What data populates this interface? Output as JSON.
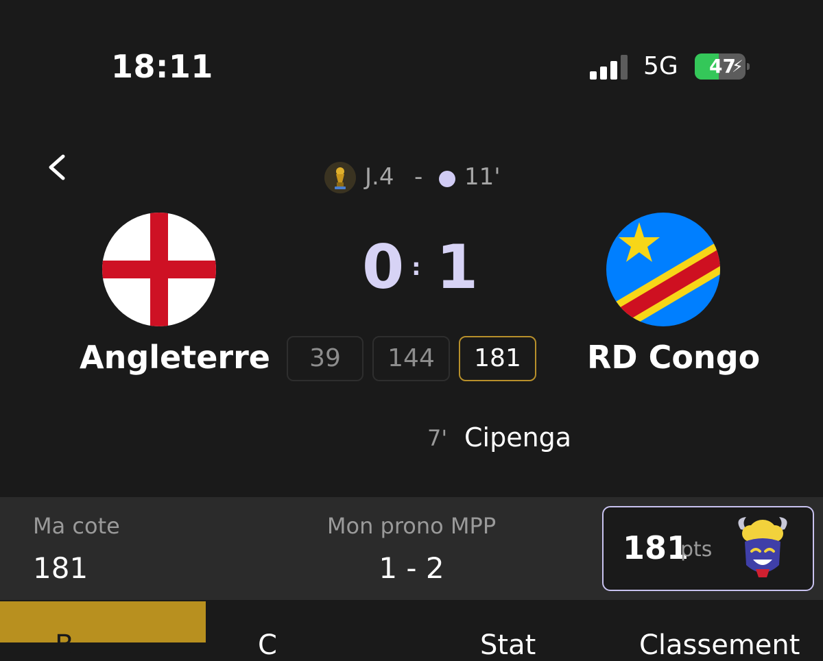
{
  "status_bar": {
    "time": "18:11",
    "network": "5G",
    "battery": "47",
    "battery_fraction": 0.47,
    "battery_color": "#34c759"
  },
  "header": {
    "back_icon": "chevron-left-icon",
    "competition_icon": "trophy-icon",
    "round": "J.4",
    "separator": "-",
    "live_minute": "11'"
  },
  "match": {
    "home": {
      "name": "Angleterre",
      "score": "0",
      "flag": "england-flag"
    },
    "away": {
      "name": "RD Congo",
      "score": "1",
      "flag": "dr-congo-flag"
    },
    "score_separator": ":",
    "odds": [
      {
        "value": "39",
        "selected": false
      },
      {
        "value": "144",
        "selected": false
      },
      {
        "value": "181",
        "selected": true
      }
    ],
    "events": [
      {
        "minute": "7'",
        "player": "Cipenga"
      }
    ]
  },
  "summary": {
    "my_odds_label": "Ma cote",
    "my_odds_value": "181",
    "prono_label": "Mon prono MPP",
    "prono_value": "1 - 2",
    "points_value": "181",
    "points_unit": "pts",
    "mascot_icon": "goat-mascot-icon"
  },
  "tabs": [
    {
      "label": "B",
      "active": true
    },
    {
      "label": "C",
      "active": false
    },
    {
      "label": "Stat",
      "active": false
    },
    {
      "label": "Classement",
      "active": false
    }
  ],
  "colors": {
    "background": "#1a1a1a",
    "score": "#d7d3f5",
    "accent_gold": "#b8901f",
    "selected_border": "#b8902b"
  }
}
